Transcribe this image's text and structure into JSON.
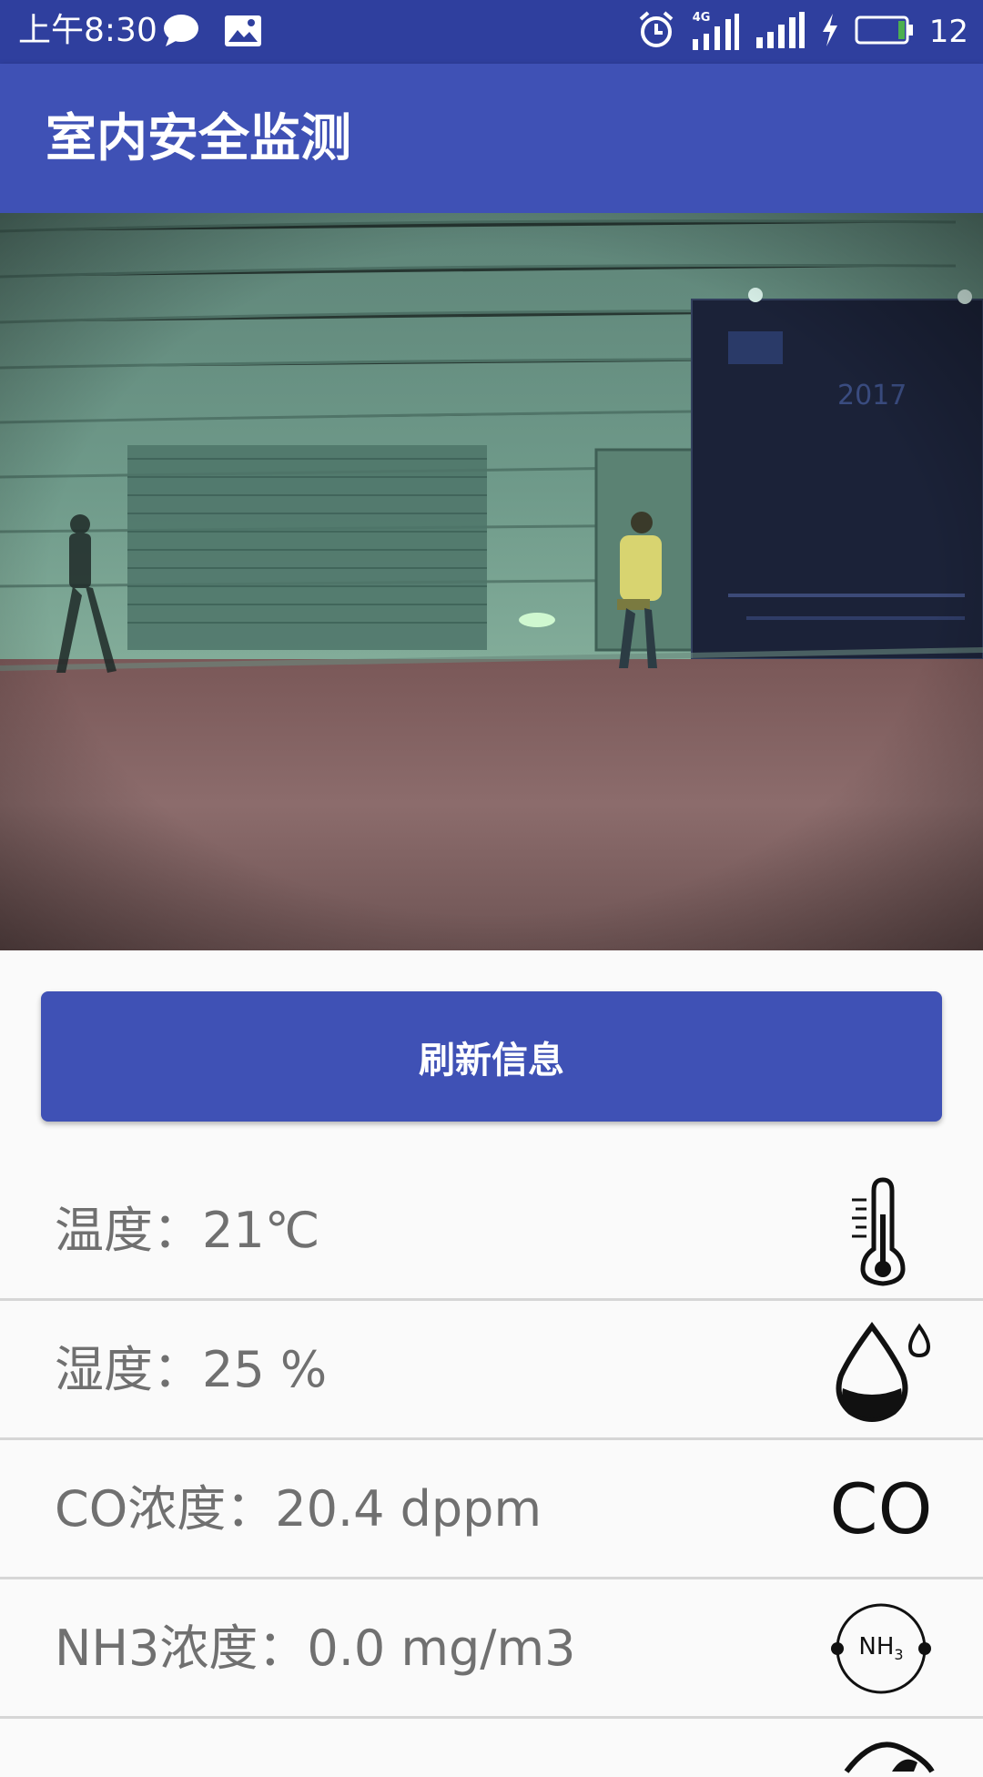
{
  "status_bar": {
    "time": "上午8:30",
    "network": "4G",
    "battery_level": "12"
  },
  "app_bar": {
    "title": "室内安全监测"
  },
  "camera": {
    "banner_text": "2017"
  },
  "refresh_button": {
    "label": "刷新信息"
  },
  "sensors": [
    {
      "label": "温度：21℃",
      "icon": "thermometer-icon"
    },
    {
      "label": "湿度：25 %",
      "icon": "humidity-drop-icon"
    },
    {
      "label": "CO浓度：20.4 dppm",
      "icon": "co-icon",
      "icon_text": "CO"
    },
    {
      "label": "NH3浓度：0.0 mg/m3",
      "icon": "nh3-icon",
      "icon_text": "NH",
      "icon_sub": "3"
    }
  ],
  "colors": {
    "status_bar": "#2f3f9e",
    "primary": "#3f51b5",
    "text_secondary": "#707070",
    "divider": "#d6d6d6"
  }
}
